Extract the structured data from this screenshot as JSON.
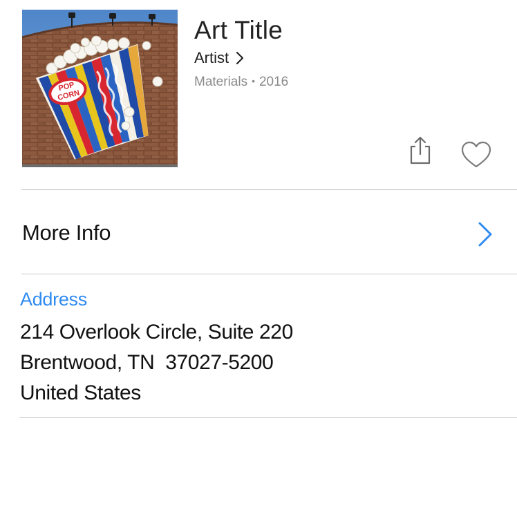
{
  "header": {
    "title": "Art Title",
    "artist_label": "Artist",
    "materials": "Materials",
    "separator": "•",
    "year": "2016",
    "artwork_badge_text": "POP CORN"
  },
  "more_info": {
    "label": "More Info"
  },
  "address": {
    "heading": "Address",
    "lines": [
      "214 Overlook Circle, Suite 220",
      "Brentwood, TN  37027-5200",
      "United States"
    ]
  },
  "icons": {
    "share": "share-icon",
    "favorite": "heart-icon",
    "artist_chevron": "chevron-right-icon",
    "more_info_chevron": "chevron-right-icon"
  },
  "colors": {
    "accent": "#2f8bf2",
    "secondary_text": "#8a8a8a",
    "divider": "#c8c8c8",
    "icon_gray": "#6b6b6b"
  }
}
